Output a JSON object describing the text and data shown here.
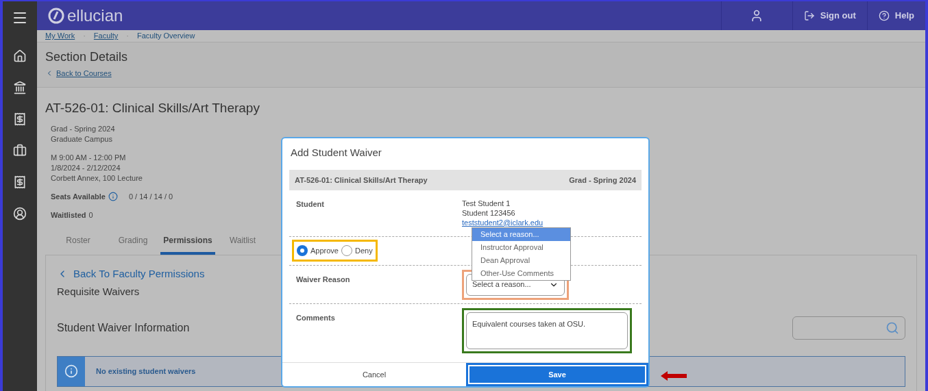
{
  "header": {
    "logo_text": "ellucian",
    "actions": [
      {
        "kind": "user"
      },
      {
        "kind": "signout",
        "label": "Sign out"
      },
      {
        "kind": "help",
        "label": "Help"
      }
    ]
  },
  "breadcrumb_separator": "·",
  "breadcrumbs": [
    {
      "label": "My Work",
      "link": true
    },
    {
      "label": "Faculty",
      "link": true
    },
    {
      "label": "Faculty Overview",
      "link": false
    }
  ],
  "page_title": "Section Details",
  "back_link": "Back to Courses",
  "course": {
    "title": "AT-526-01: Clinical Skills/Art Therapy",
    "term_lines": [
      "Grad - Spring 2024",
      "Graduate Campus"
    ],
    "meeting_lines": [
      "M 9:00 AM - 12:00 PM",
      "1/8/2024 - 2/12/2024",
      "Corbett Annex, 100 Lecture"
    ],
    "seats_label": "Seats Available",
    "seats_value": "0 / 14 / 14 / 0",
    "waitlisted_label": "Waitlisted",
    "waitlisted_value": "0"
  },
  "tabs": [
    {
      "label": "Roster",
      "selected": false
    },
    {
      "label": "Grading",
      "selected": false
    },
    {
      "label": "Permissions",
      "selected": true
    },
    {
      "label": "Waitlist",
      "selected": false
    }
  ],
  "panel": {
    "back_link": "Back To Faculty Permissions",
    "heading": "Requisite Waivers",
    "subheading": "Student Waiver Information",
    "alert": "No existing student waivers"
  },
  "modal": {
    "title": "Add Student Waiver",
    "course": "AT-526-01: Clinical Skills/Art Therapy",
    "term": "Grad - Spring 2024",
    "student_label": "Student",
    "student_name": "Test Student 1",
    "student_id": "Student 123456",
    "student_email": "teststudent2@iclark.edu",
    "decision": [
      {
        "label": "Approve",
        "selected": true
      },
      {
        "label": "Deny",
        "selected": false
      }
    ],
    "reason_label": "Waiver Reason",
    "reason_value": "Select a reason...",
    "reason_options": [
      {
        "label": "Select a reason...",
        "selected": true
      },
      {
        "label": "Instructor Approval",
        "selected": false
      },
      {
        "label": "Dean Approval",
        "selected": false
      },
      {
        "label": "Other-Use Comments",
        "selected": false
      }
    ],
    "comments_label": "Comments",
    "comments_value": "Equivalent courses taken at OSU.",
    "cancel": "Cancel",
    "save": "Save"
  }
}
